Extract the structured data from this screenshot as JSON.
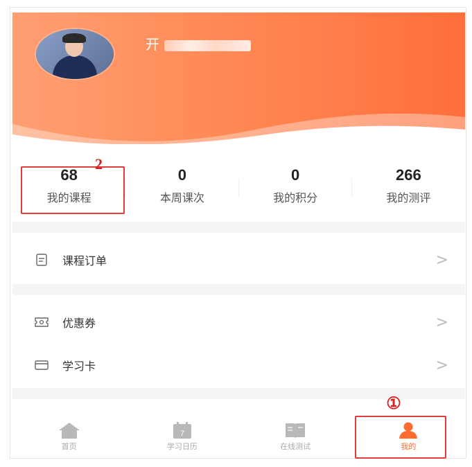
{
  "profile": {
    "name": "开"
  },
  "stats": [
    {
      "value": "68",
      "label": "我的课程"
    },
    {
      "value": "0",
      "label": "本周课次"
    },
    {
      "value": "0",
      "label": "我的积分"
    },
    {
      "value": "266",
      "label": "我的测评"
    }
  ],
  "menu": {
    "orders": {
      "label": "课程订单",
      "icon": "document-icon"
    },
    "coupons": {
      "label": "优惠券",
      "icon": "ticket-icon"
    },
    "study_card": {
      "label": "学习卡",
      "icon": "card-icon"
    }
  },
  "tabbar": [
    {
      "label": "首页",
      "icon": "home-icon"
    },
    {
      "label": "学习日历",
      "icon": "calendar-icon",
      "badge": "7"
    },
    {
      "label": "在线测试",
      "icon": "book-icon"
    },
    {
      "label": "我的",
      "icon": "person-icon"
    }
  ],
  "annotations": {
    "one": "①",
    "two": "2"
  },
  "colors": {
    "accent": "#ff6b2c",
    "header_start": "#ff9f73",
    "header_end": "#ff6f3b",
    "annotation": "#e53a3a"
  }
}
